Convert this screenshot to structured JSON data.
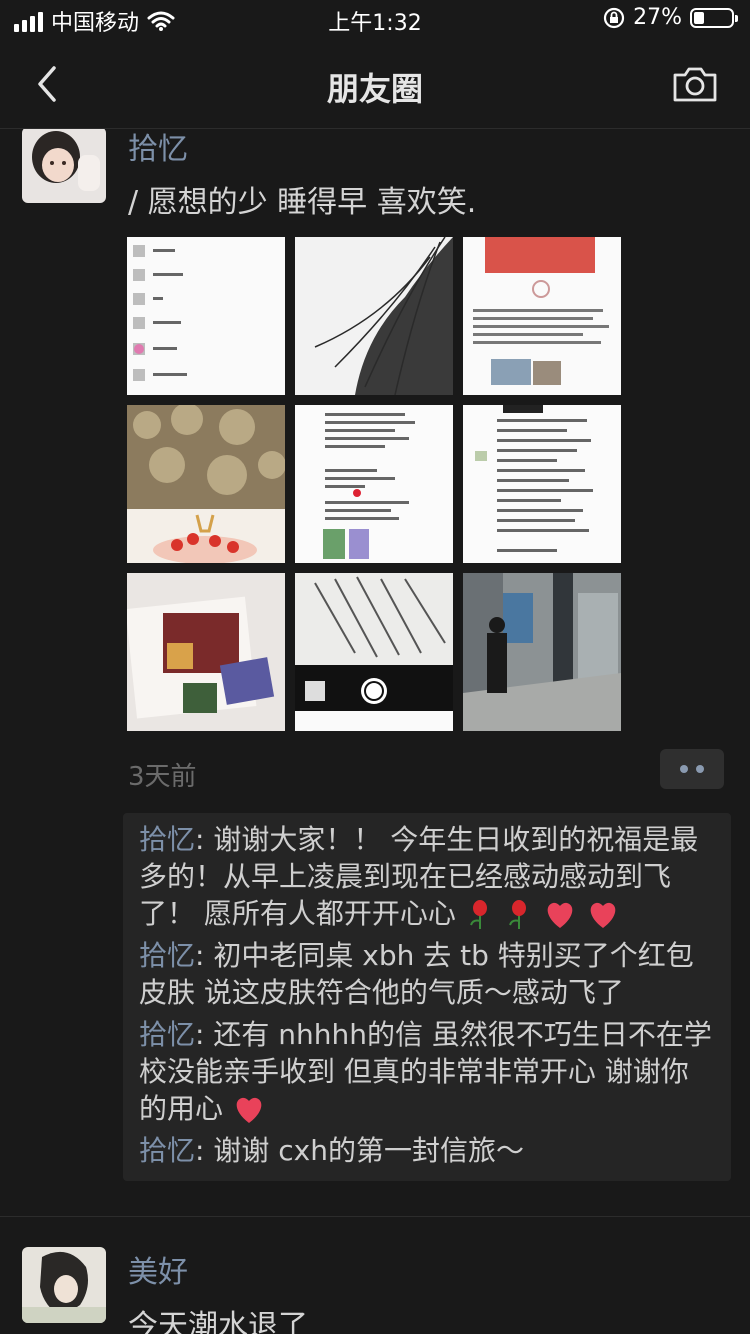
{
  "status_bar": {
    "carrier": "中国移动",
    "time": "上午1:32",
    "battery_percent": "27%",
    "battery_level": 0.27
  },
  "nav": {
    "title": "朋友圈",
    "back_icon": "chevron-left-icon",
    "camera_icon": "camera-icon"
  },
  "posts": [
    {
      "author": "拾忆",
      "text": "/ 愿想的少 睡得早 喜欢笑.",
      "time": "3天前",
      "images": [
        {
          "name": "chat-list-screenshot"
        },
        {
          "name": "hair-photo"
        },
        {
          "name": "red-packet-screenshot"
        },
        {
          "name": "cake-photo"
        },
        {
          "name": "birthday-message-screenshot"
        },
        {
          "name": "chat-screenshot"
        },
        {
          "name": "letter-card-photo"
        },
        {
          "name": "camera-letter-photo"
        },
        {
          "name": "hallway-photo"
        }
      ],
      "comments": [
        {
          "name": "拾忆",
          "sep": ": ",
          "text": "谢谢大家！！ 今年生日收到的祝福是最多的！从早上凌晨到现在已经感动感动到飞了！ 愿所有人都开开心心",
          "emojis": [
            "rose-emoji",
            "rose-emoji",
            "heart-emoji",
            "heart-emoji"
          ]
        },
        {
          "name": "拾忆",
          "sep": ": ",
          "text": "初中老同桌 xbh 去 tb 特别买了个红包皮肤 说这皮肤符合他的气质～感动飞了",
          "emojis": []
        },
        {
          "name": "拾忆",
          "sep": ": ",
          "text": "还有 nhhhh的信 虽然很不巧生日不在学校没能亲手收到 但真的非常非常开心 谢谢你的用心",
          "emojis": [
            "heart-emoji"
          ]
        },
        {
          "name": "拾忆",
          "sep": ": ",
          "text": "谢谢 cxh的第一封信旅～",
          "emojis": []
        }
      ]
    },
    {
      "author": "美好",
      "text": "今天潮水退了"
    }
  ]
}
